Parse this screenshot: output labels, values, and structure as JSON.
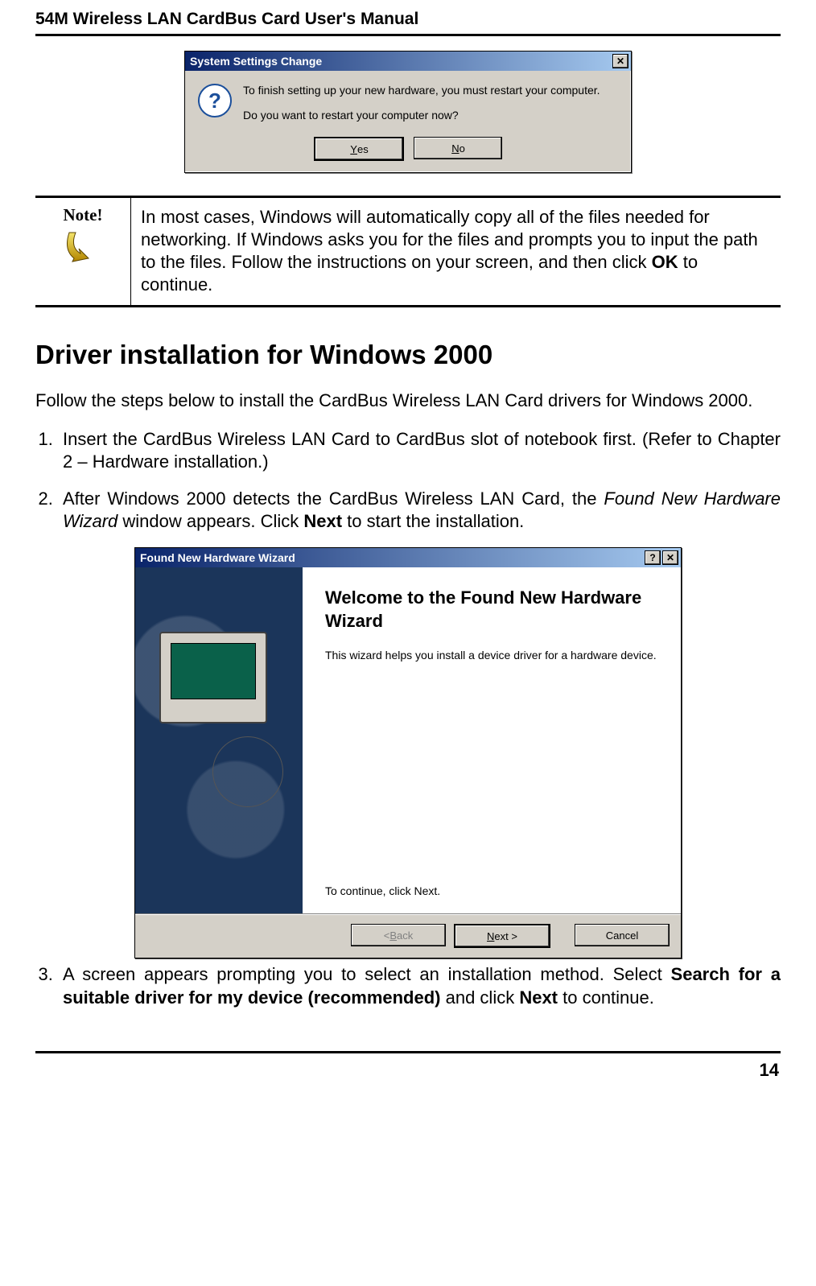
{
  "running_head": "54M Wireless LAN CardBus Card User's Manual",
  "page_number": "14",
  "ssc": {
    "title": "System Settings Change",
    "line1": "To finish setting up your new hardware, you must restart your computer.",
    "line2": "Do you want to restart your computer now?",
    "yes_u": "Y",
    "yes_rest": "es",
    "no_u": "N",
    "no_rest": "o",
    "close_glyph": "✕"
  },
  "note": {
    "label": "Note!",
    "text_pre": "In most cases, Windows will automatically copy all of the files needed for networking. If Windows asks you for the files and prompts you to input the path to the files. Follow the instructions on your screen, and then click ",
    "ok": "OK",
    "text_post": " to continue."
  },
  "section_title": "Driver installation for Windows 2000",
  "intro": "Follow the steps below to install the CardBus Wireless LAN Card drivers for Windows 2000.",
  "step1": "Insert the CardBus Wireless LAN Card to CardBus slot of notebook first. (Refer to Chapter 2 – Hardware installation.)",
  "step2": {
    "pre": "After Windows 2000 detects the CardBus Wireless LAN Card, the ",
    "ital": "Found New Hardware Wizard",
    "mid": " window appears. Click ",
    "bold": "Next",
    "post": " to start the installation."
  },
  "fnh": {
    "title": "Found New Hardware Wizard",
    "help_glyph": "?",
    "close_glyph": "✕",
    "heading": "Welcome to the Found New Hardware Wizard",
    "p1": "This wizard helps you install a device driver for a hardware device.",
    "cont": "To continue, click Next.",
    "back_u": "B",
    "back_rest": "ack",
    "back_prefix": "< ",
    "next_u": "N",
    "next_rest": "ext >",
    "cancel": "Cancel"
  },
  "step3": {
    "pre": "A screen appears prompting you to select an installation method. Select ",
    "bold1": "Search for a suitable driver for my device (recommended)",
    "mid": " and click ",
    "bold2": "Next",
    "post": " to continue."
  }
}
